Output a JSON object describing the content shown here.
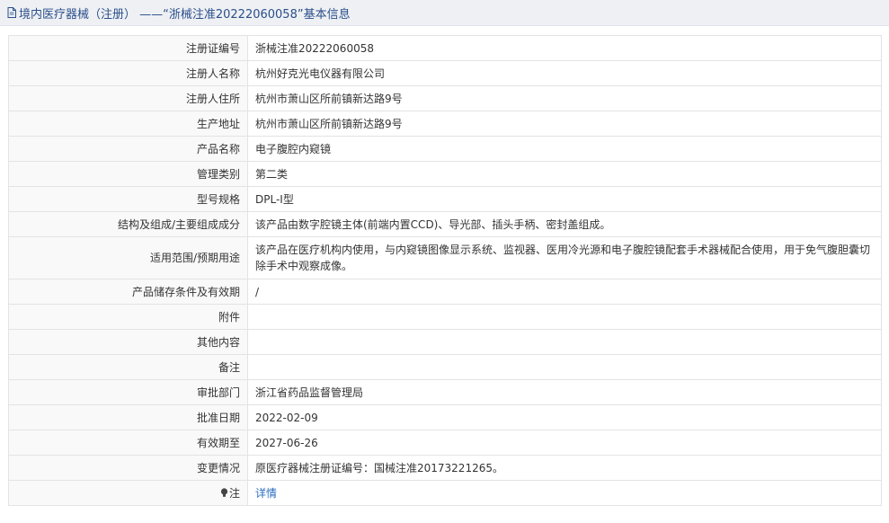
{
  "header": {
    "title": "境内医疗器械（注册） ——“浙械注准20222060058”基本信息",
    "icon": "document-icon"
  },
  "rows": [
    {
      "label": "注册证编号",
      "value": "浙械注准20222060058"
    },
    {
      "label": "注册人名称",
      "value": "杭州好克光电仪器有限公司"
    },
    {
      "label": "注册人住所",
      "value": "杭州市萧山区所前镇新达路9号"
    },
    {
      "label": "生产地址",
      "value": "杭州市萧山区所前镇新达路9号"
    },
    {
      "label": "产品名称",
      "value": "电子腹腔内窥镜"
    },
    {
      "label": "管理类别",
      "value": "第二类"
    },
    {
      "label": "型号规格",
      "value": "DPL-Ⅰ型"
    },
    {
      "label": "结构及组成/主要组成成分",
      "value": "该产品由数字腔镜主体(前端内置CCD)、导光部、插头手柄、密封盖组成。"
    },
    {
      "label": "适用范围/预期用途",
      "value": "该产品在医疗机构内使用，与内窥镜图像显示系统、监视器、医用冷光源和电子腹腔镜配套手术器械配合使用，用于免气腹胆囊切除手术中观察成像。"
    },
    {
      "label": "产品储存条件及有效期",
      "value": "/"
    },
    {
      "label": "附件",
      "value": ""
    },
    {
      "label": "其他内容",
      "value": ""
    },
    {
      "label": "备注",
      "value": ""
    },
    {
      "label": "审批部门",
      "value": "浙江省药品监督管理局"
    },
    {
      "label": "批准日期",
      "value": "2022-02-09"
    },
    {
      "label": "有效期至",
      "value": "2027-06-26"
    },
    {
      "label": "变更情况",
      "value": "原医疗器械注册证编号：国械注准20173221265。"
    }
  ],
  "note": {
    "label": "注",
    "link": "详情",
    "icon": "lightbulb-icon"
  },
  "colors": {
    "title": "#2a4f8a",
    "link": "#2a6cc0",
    "header_bg": "#eef0f4",
    "border": "#e3e3e3"
  }
}
